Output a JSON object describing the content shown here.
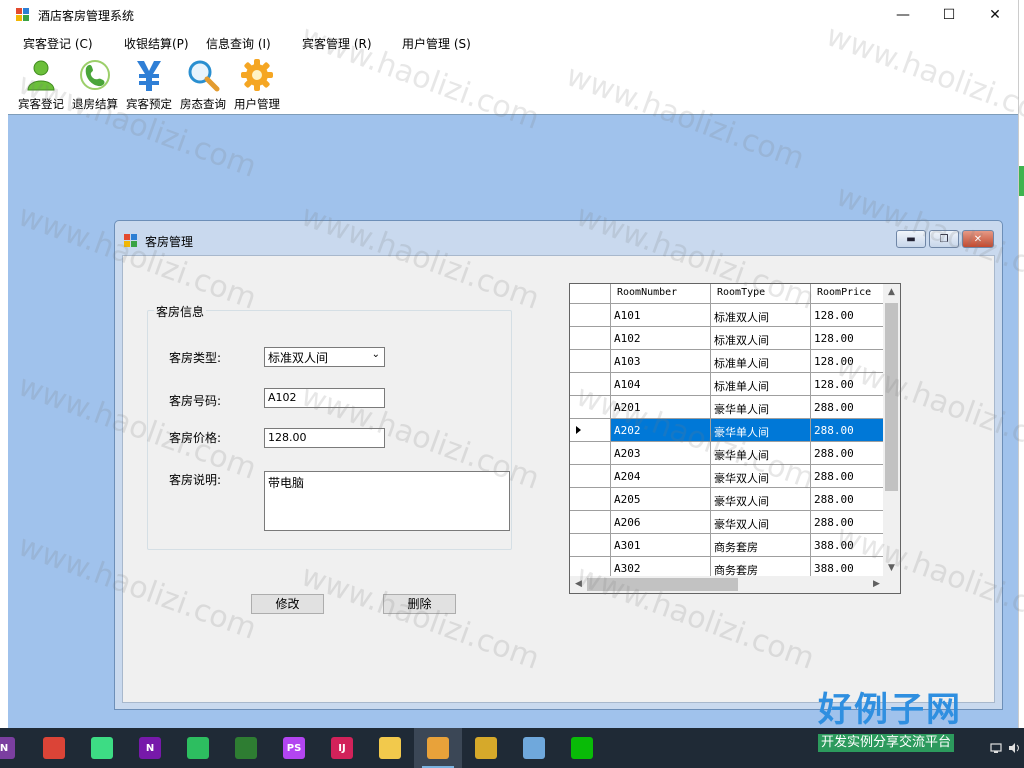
{
  "app": {
    "title": "酒店客房管理系统",
    "window_controls": [
      "—",
      "☐",
      "✕"
    ]
  },
  "menu": [
    {
      "label": "宾客登记 (C)"
    },
    {
      "label": "收银结算(P)"
    },
    {
      "label": "信息查询 (I)"
    },
    {
      "label": "宾客管理 (R)"
    },
    {
      "label": "用户管理 (S)"
    }
  ],
  "toolbar": [
    {
      "label": "宾客登记",
      "icon": "user-icon"
    },
    {
      "label": "退房结算",
      "icon": "phone-icon"
    },
    {
      "label": "宾客预定",
      "icon": "yen-icon"
    },
    {
      "label": "房态查询",
      "icon": "magnifier-icon"
    },
    {
      "label": "用户管理",
      "icon": "gear-icon"
    }
  ],
  "child": {
    "title": "客房管理",
    "group_title": "客房信息",
    "fields": {
      "type_label": "客房类型:",
      "type_value": "标准双人间",
      "number_label": "客房号码:",
      "number_value": "A102",
      "price_label": "客房价格:",
      "price_value": "128.00",
      "desc_label": "客房说明:",
      "desc_value": "带电脑"
    },
    "buttons": {
      "modify": "修改",
      "delete": "删除"
    },
    "grid": {
      "columns": [
        "RoomNumber",
        "RoomType",
        "RoomPrice"
      ],
      "selected_row": 5,
      "rows": [
        [
          "A101",
          "标准双人间",
          "128.00"
        ],
        [
          "A102",
          "标准双人间",
          "128.00"
        ],
        [
          "A103",
          "标准单人间",
          "128.00"
        ],
        [
          "A104",
          "标准单人间",
          "128.00"
        ],
        [
          "A201",
          "豪华单人间",
          "288.00"
        ],
        [
          "A202",
          "豪华单人间",
          "288.00"
        ],
        [
          "A203",
          "豪华单人间",
          "288.00"
        ],
        [
          "A204",
          "豪华双人间",
          "288.00"
        ],
        [
          "A205",
          "豪华双人间",
          "288.00"
        ],
        [
          "A206",
          "豪华双人间",
          "288.00"
        ],
        [
          "A301",
          "商务套房",
          "388.00"
        ],
        [
          "A302",
          "商务套房",
          "388.00"
        ]
      ]
    }
  },
  "watermark": {
    "text": "www.haolizi.com",
    "logo_big": "好例子网",
    "logo_small": "开发实例分享交流平台"
  },
  "taskbar": [
    {
      "name": "onenote-task",
      "label": "N",
      "color": "#7b3fa0"
    },
    {
      "name": "chrome-task",
      "label": "",
      "color": "#db4437"
    },
    {
      "name": "android-studio-task",
      "label": "",
      "color": "#3ddc84"
    },
    {
      "name": "onenote-app-task",
      "label": "N",
      "color": "#7719aa"
    },
    {
      "name": "evernote-task",
      "label": "",
      "color": "#2dbe60"
    },
    {
      "name": "chart-task",
      "label": "",
      "color": "#2e7d32"
    },
    {
      "name": "phpstorm-task",
      "label": "PS",
      "color": "#b345f1"
    },
    {
      "name": "intellij-task",
      "label": "IJ",
      "color": "#d2225a"
    },
    {
      "name": "explorer-task",
      "label": "",
      "color": "#f2c94c"
    },
    {
      "name": "hotel-app-task",
      "label": "",
      "color": "#e8a23a"
    },
    {
      "name": "db-tool-task",
      "label": "",
      "color": "#d6a92a"
    },
    {
      "name": "image-viewer-task",
      "label": "",
      "color": "#6fa8dc"
    },
    {
      "name": "wechat-task",
      "label": "",
      "color": "#09bb07"
    }
  ]
}
